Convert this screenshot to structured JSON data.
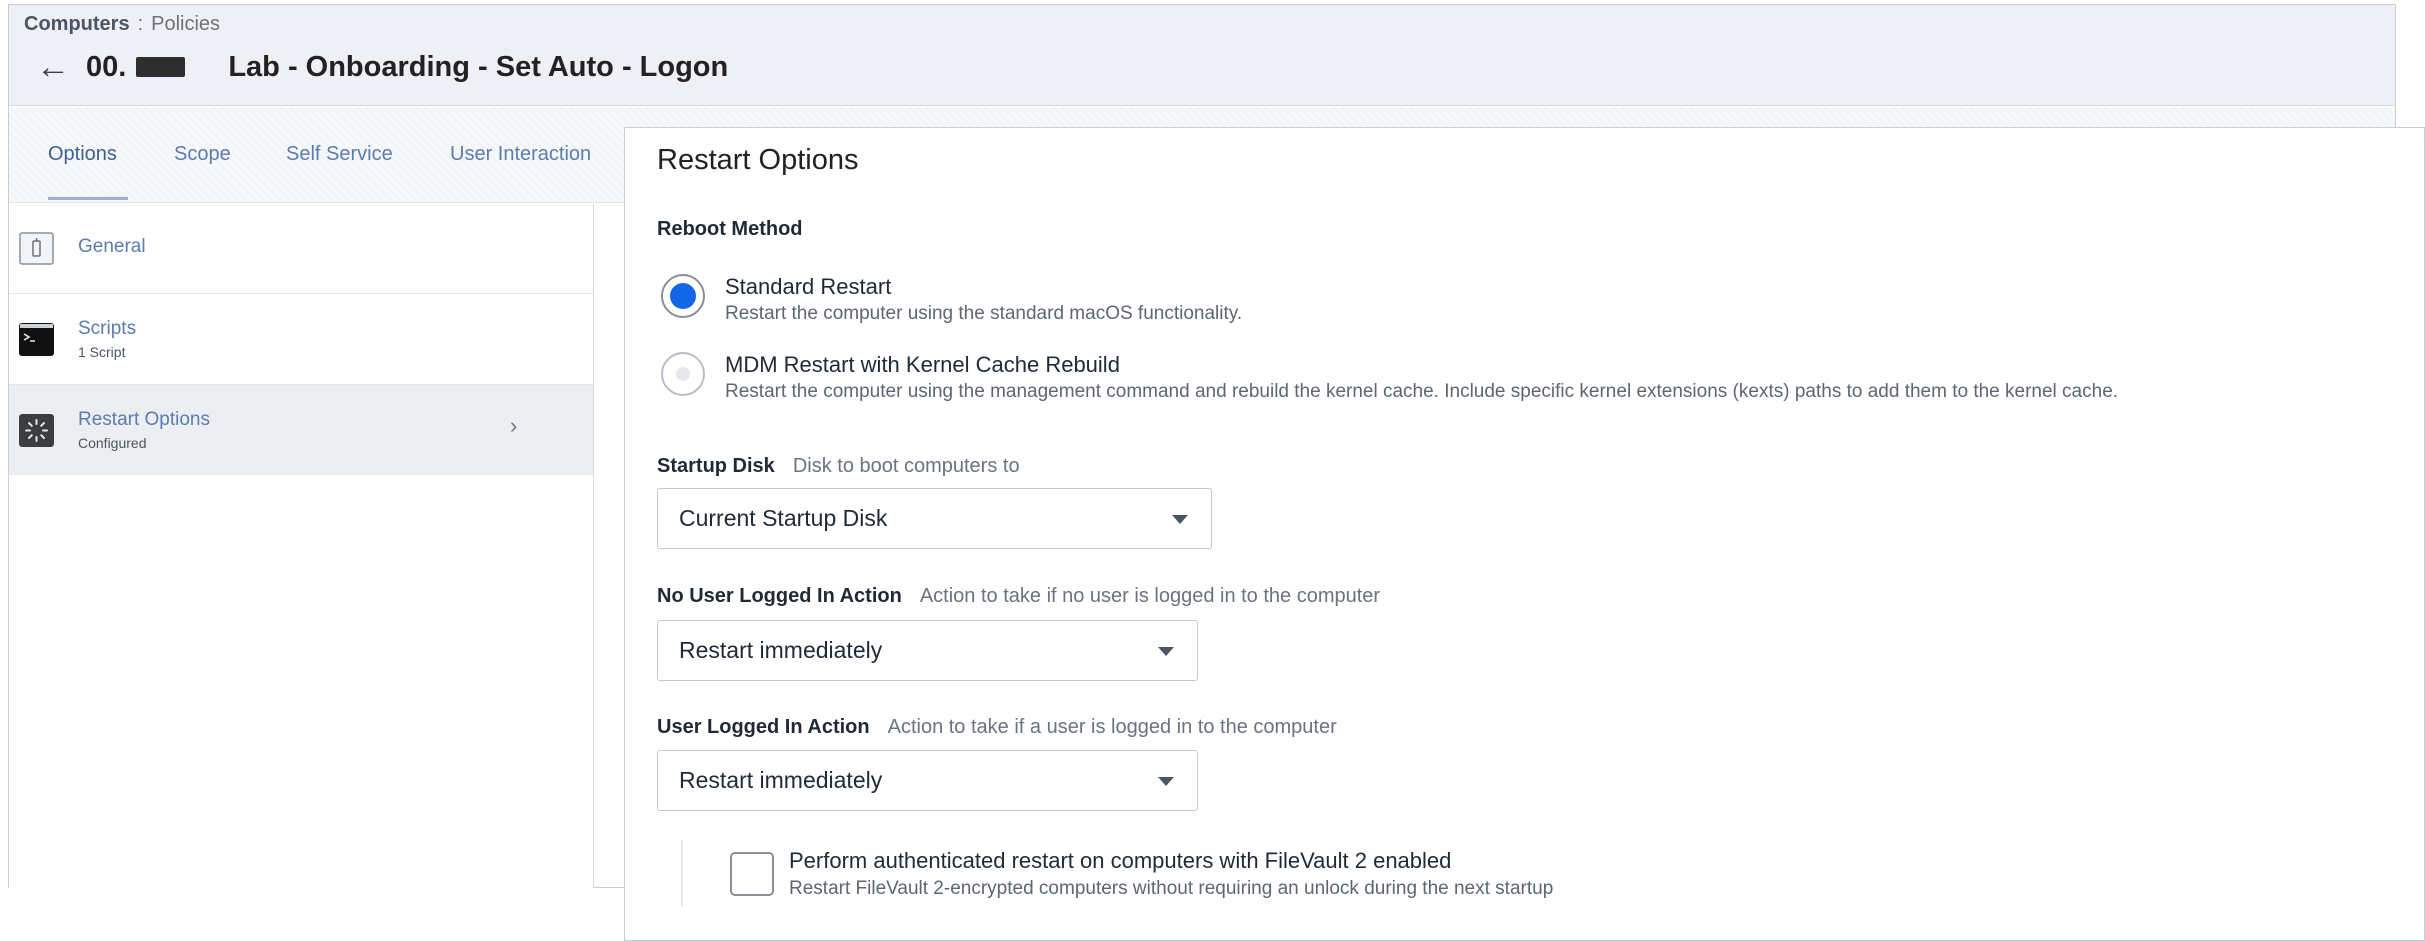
{
  "breadcrumb": {
    "section": "Computers",
    "separator": ":",
    "page": "Policies"
  },
  "header": {
    "back_icon": "←",
    "title_prefix": "00.",
    "title": "Lab - Onboarding - Set Auto - Logon"
  },
  "tabs": [
    {
      "label": "Options",
      "active": true
    },
    {
      "label": "Scope"
    },
    {
      "label": "Self Service"
    },
    {
      "label": "User Interaction"
    }
  ],
  "sidebar": {
    "items": [
      {
        "label": "General",
        "sub": "",
        "icon": "general-icon"
      },
      {
        "label": "Scripts",
        "sub": "1 Script",
        "icon": "terminal-icon"
      },
      {
        "label": "Restart Options",
        "sub": "Configured",
        "icon": "restart-icon",
        "selected": true,
        "chevron": "›"
      }
    ]
  },
  "restart_options": {
    "title": "Restart Options",
    "reboot_method_label": "Reboot Method",
    "reboot_methods": [
      {
        "title": "Standard Restart",
        "desc": "Restart the computer using the standard macOS functionality.",
        "checked": true
      },
      {
        "title": "MDM Restart with Kernel Cache Rebuild",
        "desc": "Restart the computer using the management command and rebuild the kernel cache. Include specific kernel extensions (kexts) paths to add them to the kernel cache.",
        "checked": false
      }
    ],
    "startup_disk": {
      "label": "Startup Disk",
      "hint": "Disk to boot computers to",
      "value": "Current Startup Disk"
    },
    "no_user_action": {
      "label": "No User Logged In Action",
      "hint": "Action to take if no user is logged in to the computer",
      "value": "Restart immediately"
    },
    "user_action": {
      "label": "User Logged In Action",
      "hint": "Action to take if a user is logged in to the computer",
      "value": "Restart immediately"
    },
    "filevault": {
      "title": "Perform authenticated restart on computers with FileVault 2 enabled",
      "desc": "Restart FileVault 2-encrypted computers without requiring an unlock during the next startup",
      "checked": false
    }
  },
  "colors": {
    "accent": "#1267e6",
    "link": "#5b7cae",
    "header_bg": "#eef0f5"
  }
}
